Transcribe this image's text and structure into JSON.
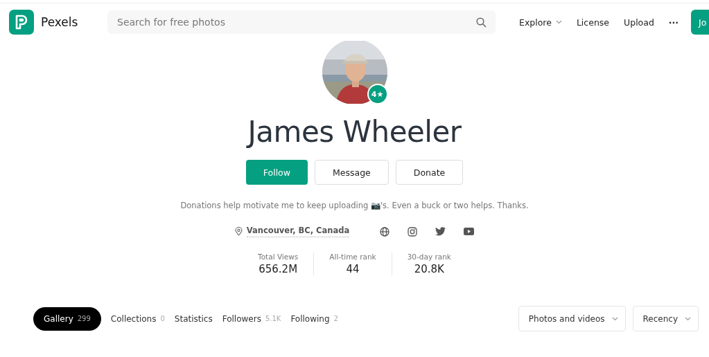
{
  "header": {
    "logo_text": "Pexels",
    "search": {
      "placeholder": "Search for free photos"
    },
    "nav": [
      {
        "label": "Explore",
        "kind": "dropdown"
      },
      {
        "label": "License",
        "kind": "link"
      },
      {
        "label": "Upload",
        "kind": "link"
      },
      {
        "label": "···",
        "kind": "more"
      }
    ],
    "join_button": "Jo"
  },
  "profile": {
    "badge": "4★",
    "name": "James Wheeler",
    "actions": [
      {
        "label": "Follow",
        "kind": "primary"
      },
      {
        "label": "Message",
        "kind": "outline"
      },
      {
        "label": "Donate",
        "kind": "outline"
      }
    ],
    "bio": "Donations help motivate me to keep uploading 📷's. Even a buck or two helps. Thanks.",
    "location": "Vancouver, BC, Canada",
    "socials": [
      {
        "kind": "globe"
      },
      {
        "kind": "instagram"
      },
      {
        "kind": "twitter"
      },
      {
        "kind": "youtube"
      }
    ],
    "stats": [
      {
        "label": "Total Views",
        "value": "656.2M"
      },
      {
        "label": "All-time rank",
        "value": "44"
      },
      {
        "label": "30-day rank",
        "value": "20.8K"
      }
    ]
  },
  "tabs": [
    {
      "label": "Gallery",
      "count": "299",
      "selected": true
    },
    {
      "label": "Collections",
      "count": "0",
      "selected": false
    },
    {
      "label": "Statistics",
      "selected": false
    },
    {
      "label": "Followers",
      "count": "5.1K",
      "selected": false
    },
    {
      "label": "Following",
      "count": "2",
      "selected": false
    }
  ],
  "filters": [
    {
      "label": "Photos and videos"
    },
    {
      "label": "Recency"
    }
  ]
}
